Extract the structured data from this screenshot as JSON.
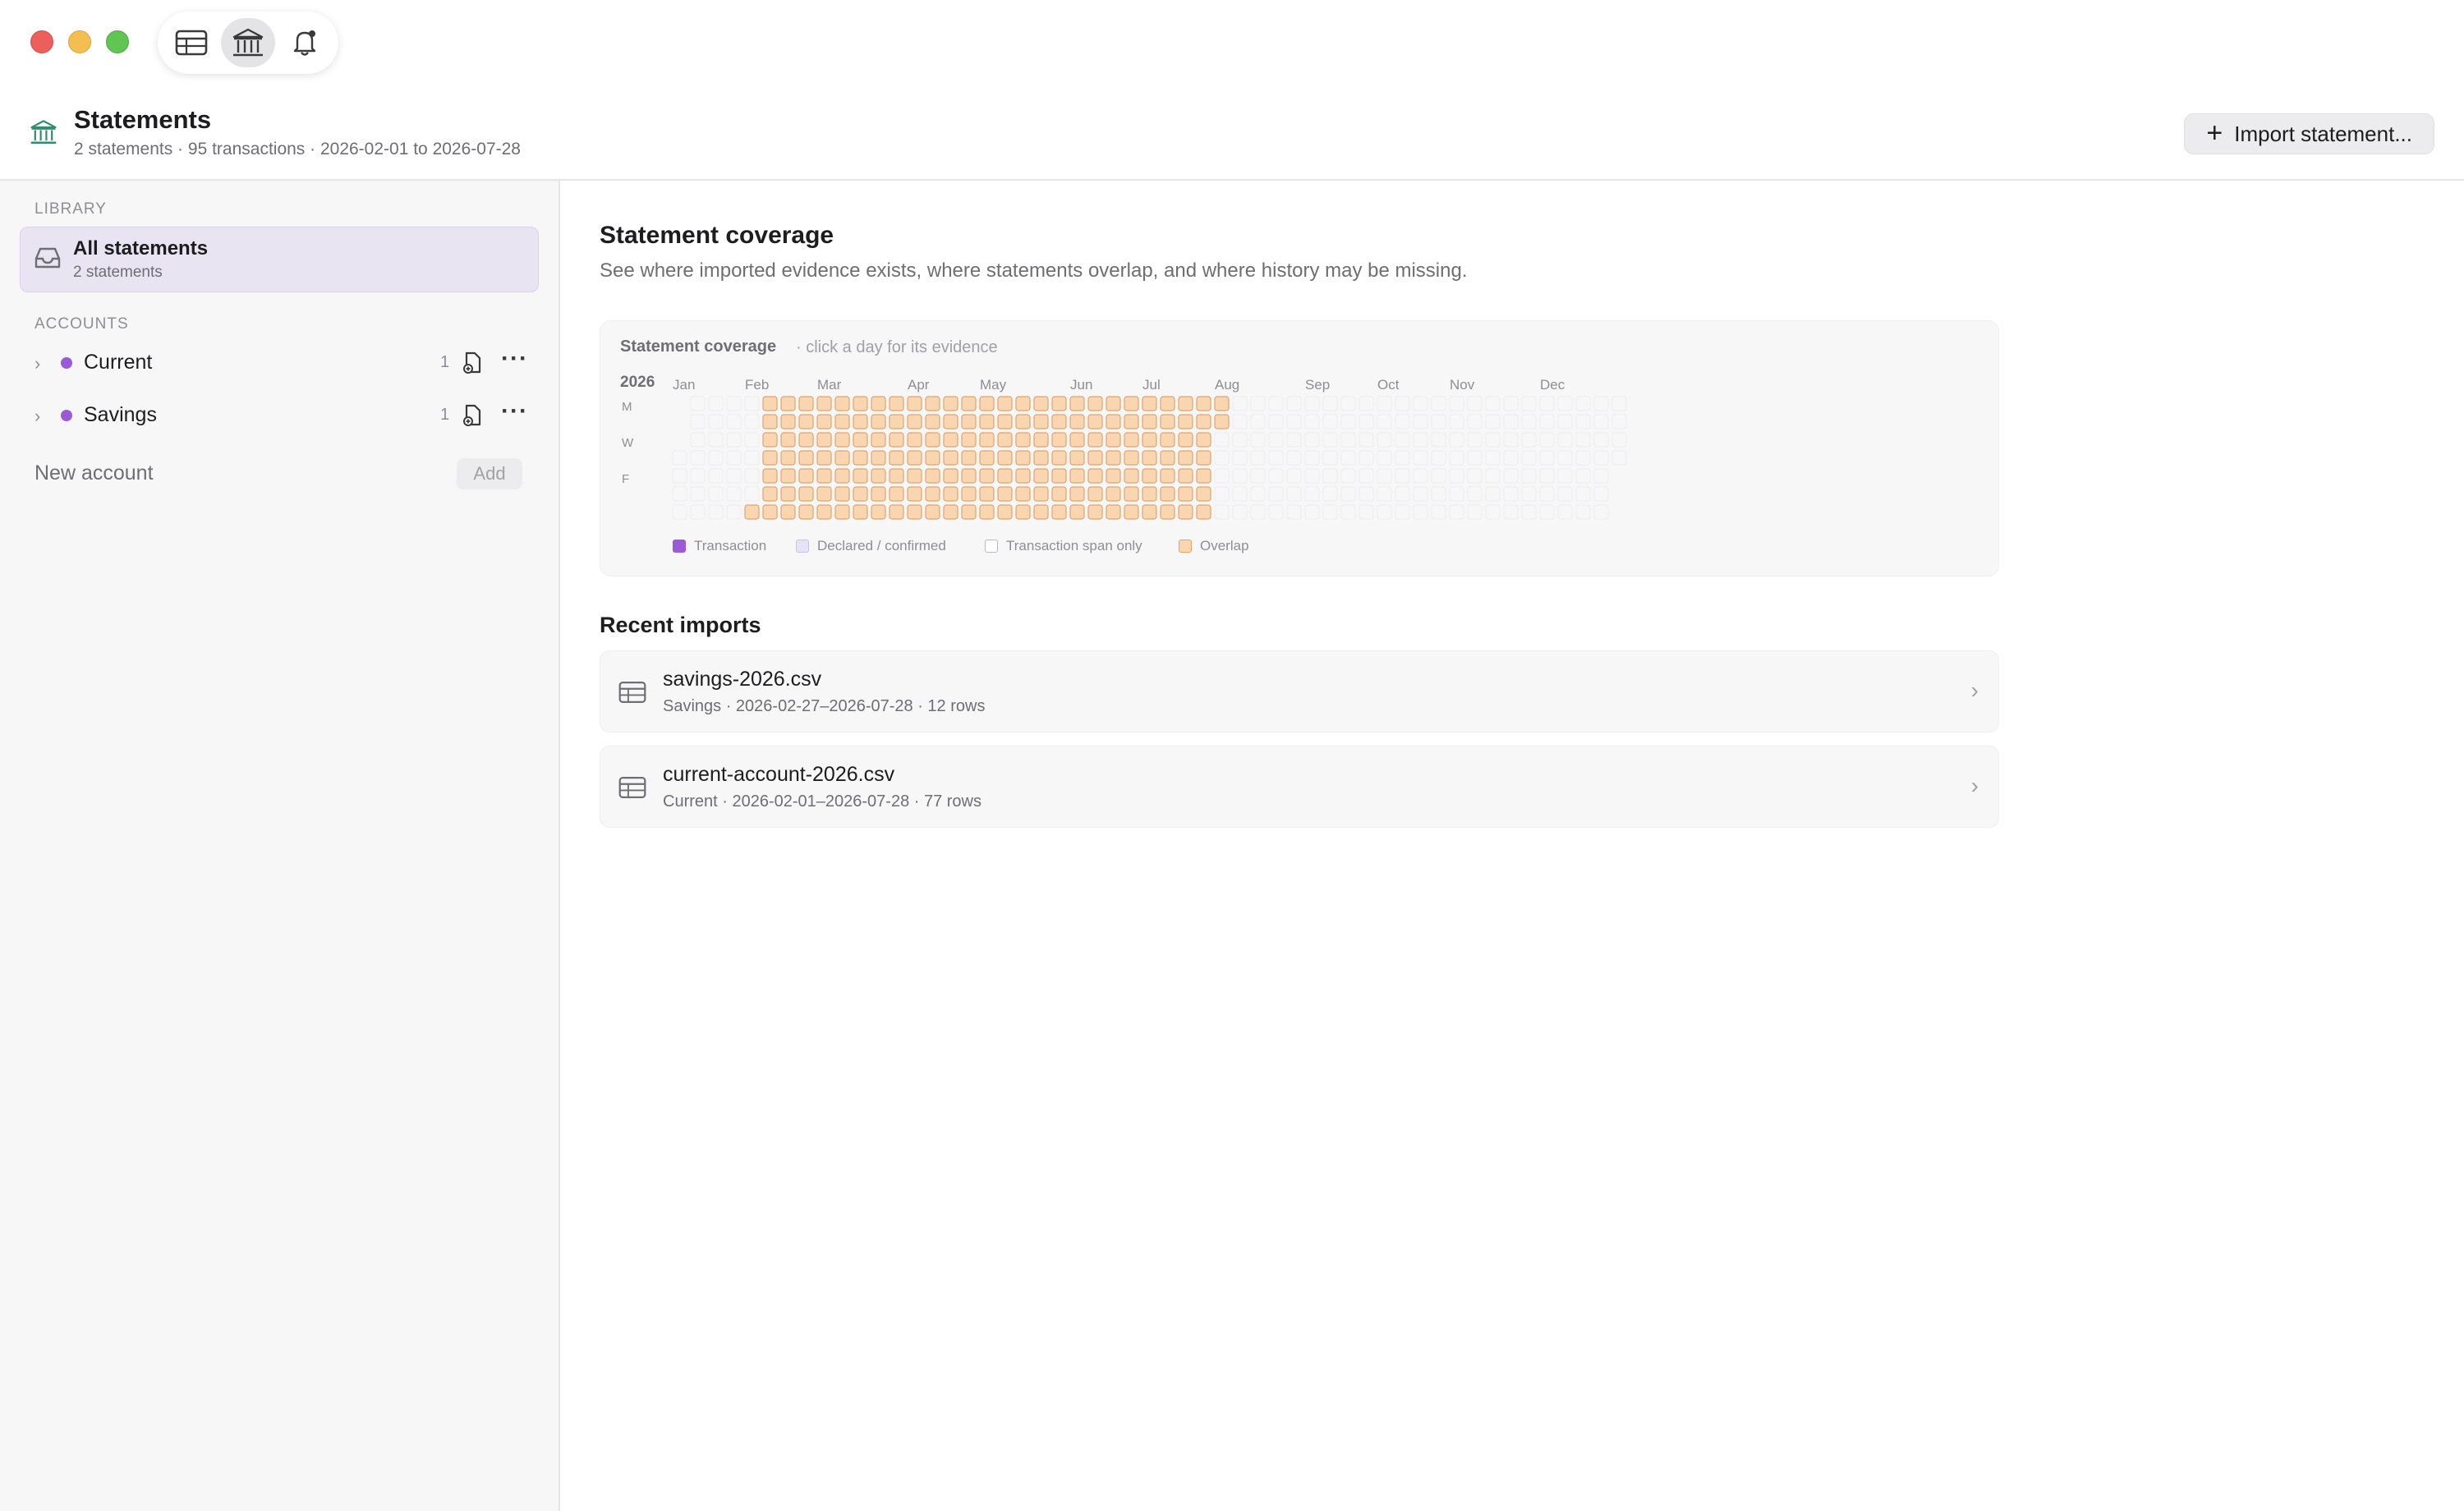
{
  "window": {
    "toolbar": {
      "buttons": [
        {
          "icon": "table-icon",
          "active": false
        },
        {
          "icon": "bank-icon",
          "active": true
        },
        {
          "icon": "bell-icon",
          "active": false
        }
      ]
    }
  },
  "header": {
    "title": "Statements",
    "subtitle": "2 statements · 95 transactions · 2026-02-01 to 2026-07-28",
    "import_button": {
      "icon": "+",
      "label": "Import statement..."
    }
  },
  "sidebar": {
    "library_label": "LIBRARY",
    "all_statements": {
      "label": "All statements",
      "sublabel": "2 statements"
    },
    "accounts_label": "ACCOUNTS",
    "accounts": [
      {
        "name": "Current",
        "count": "1",
        "color": "#9b5bd6"
      },
      {
        "name": "Savings",
        "count": "1",
        "color": "#9b5bd6"
      }
    ],
    "new_account": {
      "placeholder": "New account",
      "add_label": "Add"
    }
  },
  "main": {
    "coverage": {
      "title": "Statement coverage",
      "description": "See where imported evidence exists, where statements overlap, and where history may be missing.",
      "card_title": "Statement coverage",
      "card_hint": "· click a day for its evidence",
      "year": "2026",
      "months": [
        "Jan",
        "Feb",
        "Mar",
        "Apr",
        "May",
        "Jun",
        "Jul",
        "Aug",
        "Sep",
        "Oct",
        "Nov",
        "Dec"
      ],
      "day_labels": [
        "M",
        "W",
        "F"
      ],
      "legend": [
        {
          "label": "Transaction",
          "color": "#9b5bd6"
        },
        {
          "label": "Declared / confirmed",
          "color": "#e7e3f6"
        },
        {
          "label": "Transaction span only",
          "color": "#ffffff"
        },
        {
          "label": "Overlap",
          "color": "#f9d6b0"
        }
      ],
      "overlap_range": {
        "start": "2026-02-01",
        "end": "2026-07-28"
      },
      "colors": {
        "overlap_fill": "#f9d6b0",
        "overlap_border": "#e3a36a",
        "empty_border": "#ececef"
      }
    },
    "recent_imports": {
      "title": "Recent imports",
      "items": [
        {
          "name": "savings-2026.csv",
          "meta": "Savings · 2026-02-27–2026-07-28 · 12 rows"
        },
        {
          "name": "current-account-2026.csv",
          "meta": "Current · 2026-02-01–2026-07-28 · 77 rows"
        }
      ]
    }
  }
}
